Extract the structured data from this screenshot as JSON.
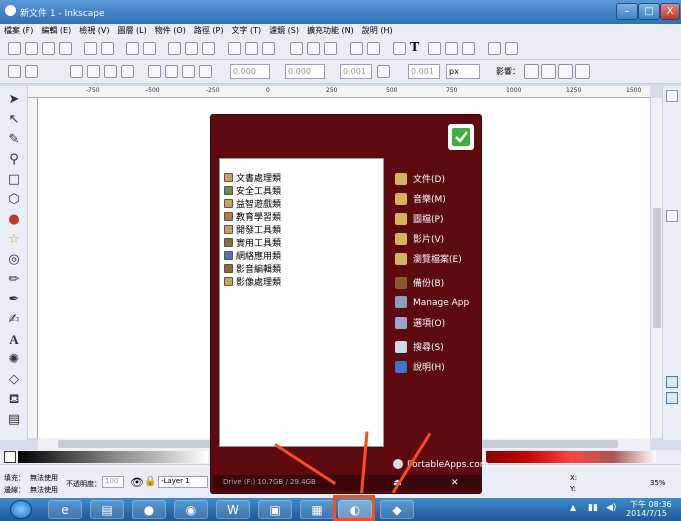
{
  "window": {
    "title": "新文件 1 - Inkscape",
    "min": "–",
    "max": "□",
    "close": "X"
  },
  "menu": [
    "檔案 (F)",
    "編輯 (E)",
    "檢視 (V)",
    "圖層 (L)",
    "物件 (O)",
    "路徑 (P)",
    "文字 (T)",
    "濾鏡 (S)",
    "擴充功能 (N)",
    "說明 (H)"
  ],
  "toolbar2": {
    "x_value": "0.000",
    "y_value": "0.000",
    "w_value": "0.001",
    "h_value": "0.001",
    "unit": "px",
    "affect_label": "影響："
  },
  "ruler_ticks": [
    "-750",
    "-500",
    "-250",
    "0",
    "250",
    "500",
    "750",
    "1000",
    "1250",
    "1500"
  ],
  "status": {
    "fill_label": "填充：",
    "fill_value": "無法使用",
    "stroke_label": "邊線：",
    "stroke_value": "無法使用",
    "opacity_label": "不透明度：",
    "opacity_value": "100",
    "layer": "-Layer 1",
    "coords_x": "X:",
    "coords_y": "Y:",
    "zoom": "35%"
  },
  "portable_apps": {
    "apps": [
      "文書處理類",
      "安全工具類",
      "益智遊戲類",
      "教育學習類",
      "開發工具類",
      "實用工具類",
      "網絡應用類",
      "影音編輯類",
      "影像處理類"
    ],
    "folders": [
      "文件(D)",
      "音樂(M)",
      "圖檔(P)",
      "影片(V)",
      "瀏覽檔案(E)"
    ],
    "actions": [
      "備份(B)",
      "Manage App",
      "選項(O)"
    ],
    "help": [
      "搜尋(S)",
      "說明(H)"
    ],
    "brand": "PortableApps.com",
    "drive": "Drive (F:) 10.7GB / 29.4GB"
  },
  "taskbar": {
    "time": "下午 08:36",
    "date": "2014/7/15"
  },
  "colors": {
    "pa_bg": "#5c0a0f",
    "accent_arrow": "#ff4b1a",
    "taskbar": "#2f6fb5"
  }
}
